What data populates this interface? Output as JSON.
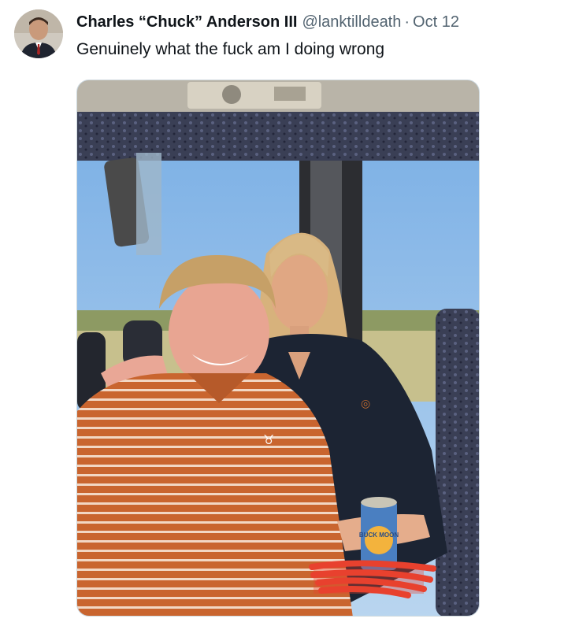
{
  "tweet": {
    "display_name": "Charles “Chuck” Anderson III",
    "handle": "@lanktilldeath",
    "separator": "·",
    "date": "Oct 12",
    "text": "Genuinely what the fuck am I doing wrong"
  },
  "photo": {
    "can_label": "BUCK MOON"
  },
  "colors": {
    "text_primary": "#0f1419",
    "text_secondary": "#536471",
    "shirt_orange": "#c9652f",
    "shirt_navy": "#1c2433",
    "redaction": "#e8412e"
  },
  "icons": {
    "avatar": "user-avatar-photo",
    "logo_shirt": "longhorn-logo-icon"
  }
}
